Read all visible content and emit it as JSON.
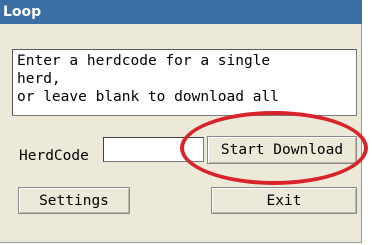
{
  "window": {
    "title": "Loop"
  },
  "message": {
    "text": "Enter a herdcode for a single\nherd,\nor leave blank to download all"
  },
  "herdcode": {
    "label": "HerdCode",
    "value": ""
  },
  "buttons": {
    "start_download": "Start Download",
    "settings": "Settings",
    "exit": "Exit"
  },
  "colors": {
    "titlebar": "#3a6ea5",
    "window_bg": "#ece9d8",
    "highlight_circle": "#d9232a"
  }
}
